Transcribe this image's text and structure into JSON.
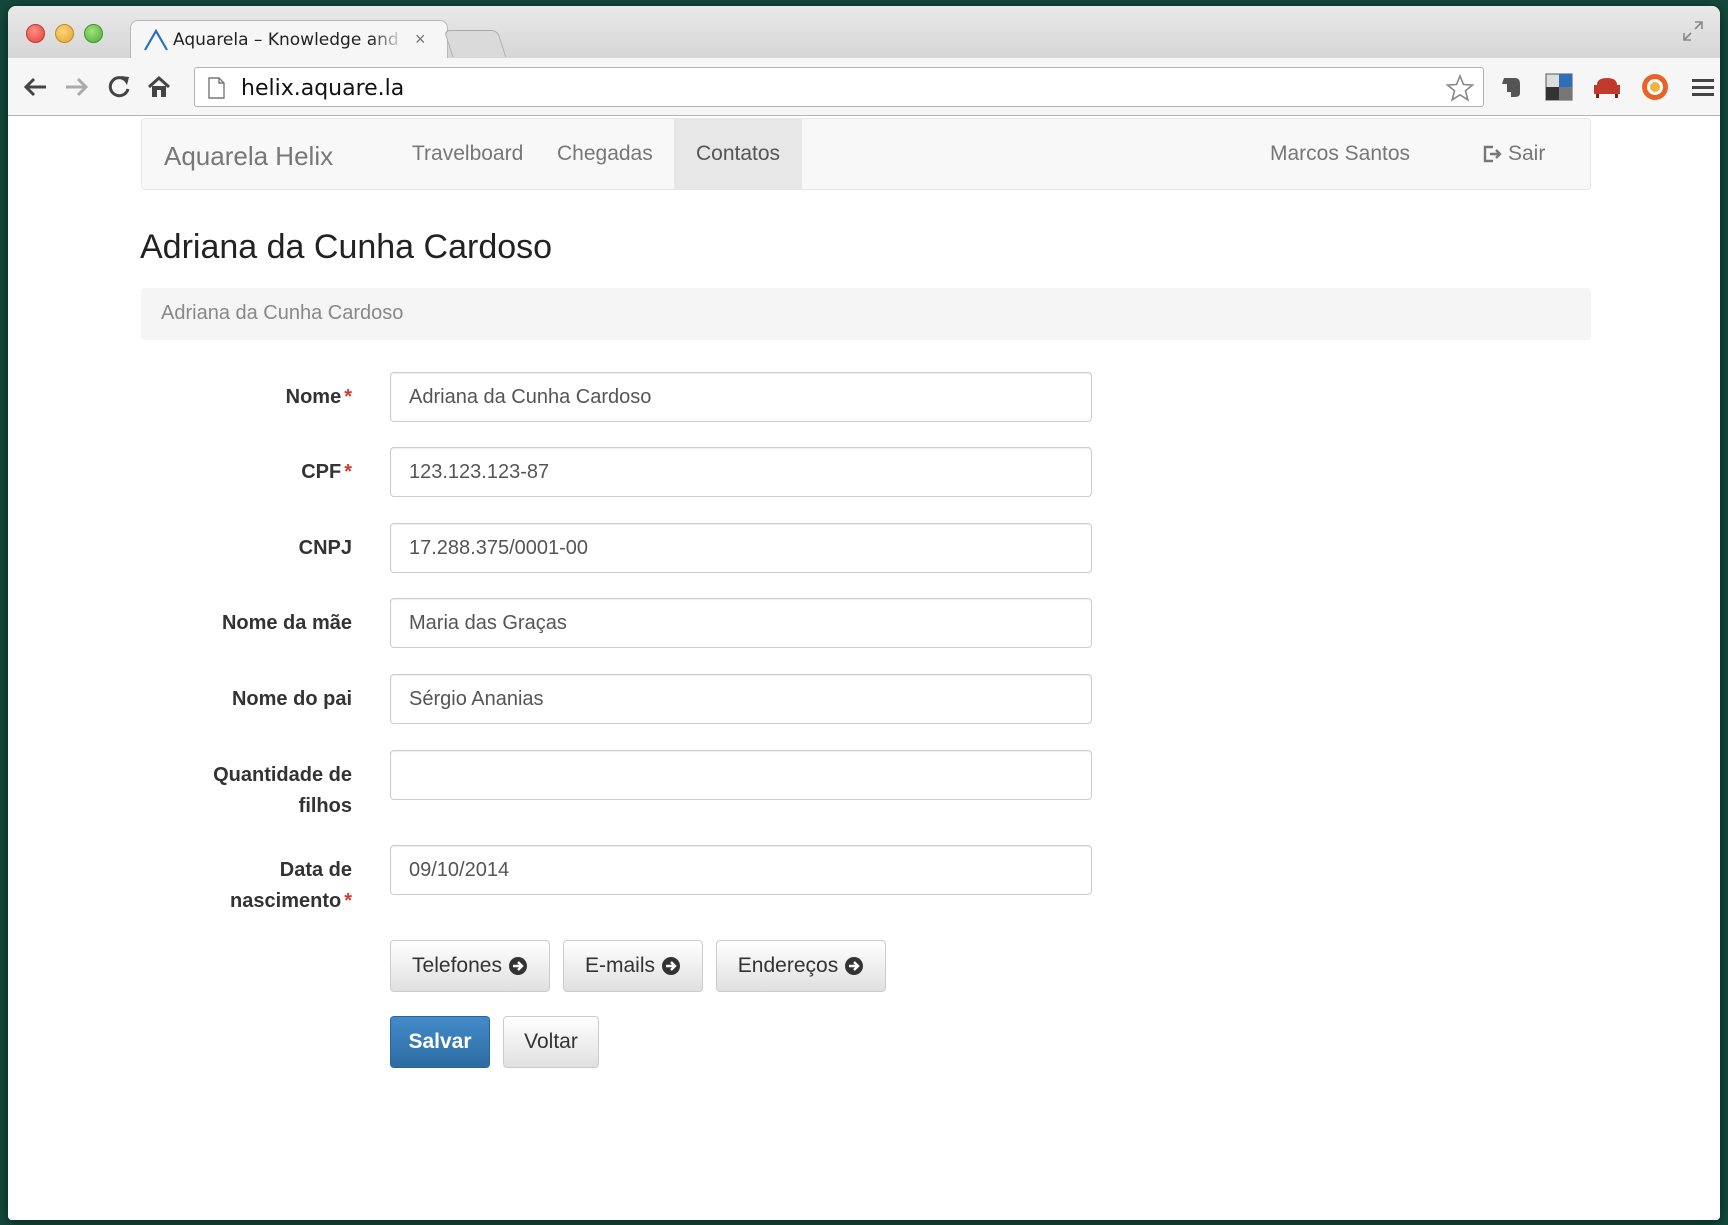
{
  "browser": {
    "tab_title": "Aquarela – Knowledge and",
    "tab_close": "×",
    "url": "helix.aquare.la"
  },
  "navbar": {
    "brand": "Aquarela Helix",
    "items": [
      {
        "label": "Travelboard",
        "active": false
      },
      {
        "label": "Chegadas",
        "active": false
      },
      {
        "label": "Contatos",
        "active": true
      }
    ],
    "user": "Marcos Santos",
    "logout": "Sair"
  },
  "page": {
    "title": "Adriana da Cunha Cardoso",
    "breadcrumb": "Adriana da Cunha Cardoso"
  },
  "form": {
    "required_mark": "*",
    "fields": [
      {
        "label": "Nome",
        "value": "Adriana da Cunha Cardoso"
      },
      {
        "label": "CPF",
        "value": "123.123.123-87"
      },
      {
        "label": "CNPJ",
        "value": "17.288.375/0001-00"
      },
      {
        "label": "Nome da mãe",
        "value": "Maria das Graças"
      },
      {
        "label": "Nome do pai",
        "value": "Sérgio Ananias"
      },
      {
        "label_line1": "Quantidade de",
        "label_line2": "filhos",
        "value": ""
      },
      {
        "label_line1": "Data de",
        "label_line2": "nascimento",
        "value": "09/10/2014"
      }
    ],
    "section_buttons": [
      "Telefones",
      "E-mails",
      "Endereços"
    ],
    "save_label": "Salvar",
    "back_label": "Voltar"
  },
  "colors": {
    "primary": "#428bca",
    "required": "#d9362c",
    "desktop": "#14493b"
  }
}
